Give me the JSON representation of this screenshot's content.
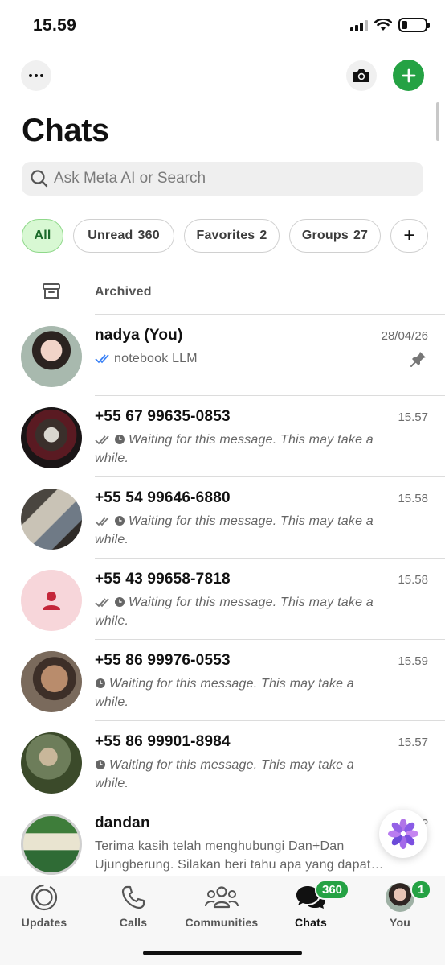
{
  "status_bar": {
    "time": "15.59",
    "battery_percent": 25
  },
  "header": {
    "title": "Chats"
  },
  "search": {
    "placeholder": "Ask Meta AI or Search"
  },
  "filters": [
    {
      "label": "All",
      "count": "",
      "active": true
    },
    {
      "label": "Unread",
      "count": "360",
      "active": false
    },
    {
      "label": "Favorites",
      "count": "2",
      "active": false
    },
    {
      "label": "Groups",
      "count": "27",
      "active": false
    }
  ],
  "add_filter_symbol": "+",
  "archived": {
    "label": "Archived"
  },
  "chats": [
    {
      "name": "nadya (You)",
      "time": "28/04/26",
      "preview": "notebook LLM",
      "pinned": true
    },
    {
      "name": "+55 67 99635-0853",
      "time": "15.57",
      "preview": "Waiting for this message. This may take a while."
    },
    {
      "name": "+55 54 99646-6880",
      "time": "15.58",
      "preview": "Waiting for this message. This may take a while."
    },
    {
      "name": "+55 43 99658-7818",
      "time": "15.58",
      "preview": "Waiting for this message. This may take a while."
    },
    {
      "name": "+55 86 99976-0553",
      "time": "15.59",
      "preview": "Waiting for this message. This may take a while."
    },
    {
      "name": "+55 86 99901-8984",
      "time": "15.57",
      "preview": "Waiting for this message. This may take a while."
    },
    {
      "name": "dandan",
      "time": "?",
      "preview": "Terima kasih telah menghubungi Dan+Dan Ujungberung. Silakan beri tahu apa yang dapat…"
    }
  ],
  "tabs": [
    {
      "label": "Updates",
      "badge": ""
    },
    {
      "label": "Calls",
      "badge": ""
    },
    {
      "label": "Communities",
      "badge": ""
    },
    {
      "label": "Chats",
      "badge": "360"
    },
    {
      "label": "You",
      "badge": "1"
    }
  ],
  "colors": {
    "accent": "#25a244",
    "chip_active_bg": "#d8f8d3",
    "read_tick": "#3b82f6"
  }
}
